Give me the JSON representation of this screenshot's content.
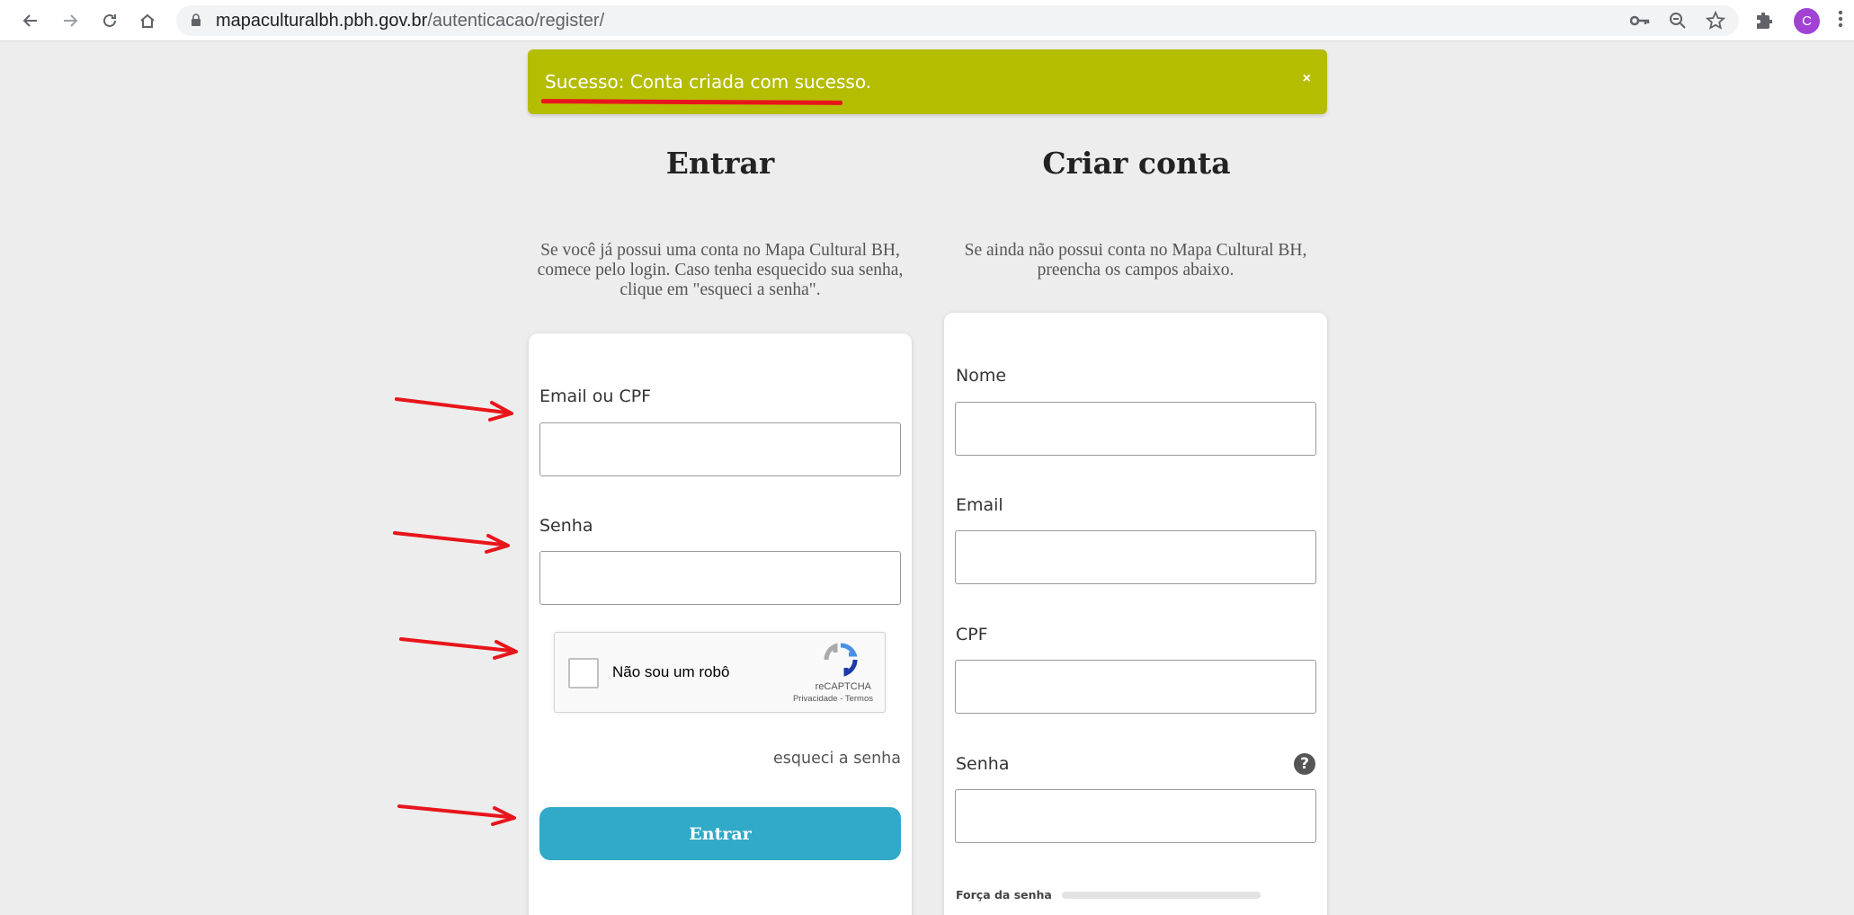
{
  "browser": {
    "url_domain": "mapaculturalbh.pbh.gov.br",
    "url_path": "/autenticacao/register/",
    "avatar_initial": "C",
    "icons": [
      "back-icon",
      "forward-icon",
      "reload-icon",
      "home-icon",
      "lock-icon",
      "key-icon",
      "zoom-icon",
      "star-icon",
      "extensions-icon",
      "menu-icon"
    ]
  },
  "alert": {
    "message": "Sucesso: Conta criada com sucesso.",
    "close": "×",
    "color": "#b5bd00"
  },
  "login": {
    "title": "Entrar",
    "description": "Se você já possui uma conta no Mapa Cultural BH, comece pelo login. Caso tenha esquecido sua senha, clique em \"esqueci a senha\".",
    "email_label": "Email ou CPF",
    "password_label": "Senha",
    "captcha_label": "Não sou um robô",
    "captcha_brand": "reCAPTCHA",
    "captcha_links": "Privacidade - Termos",
    "forgot_link": "esqueci a senha",
    "submit": "Entrar",
    "button_color": "#31a9c9"
  },
  "register": {
    "title": "Criar conta",
    "description": "Se ainda não possui conta no Mapa Cultural BH, preencha os campos abaixo.",
    "name_label": "Nome",
    "email_label": "Email",
    "cpf_label": "CPF",
    "password_label": "Senha",
    "help": "?",
    "strength_label": "Força da senha"
  },
  "annotations": {
    "mark_color": "#e8151b"
  }
}
